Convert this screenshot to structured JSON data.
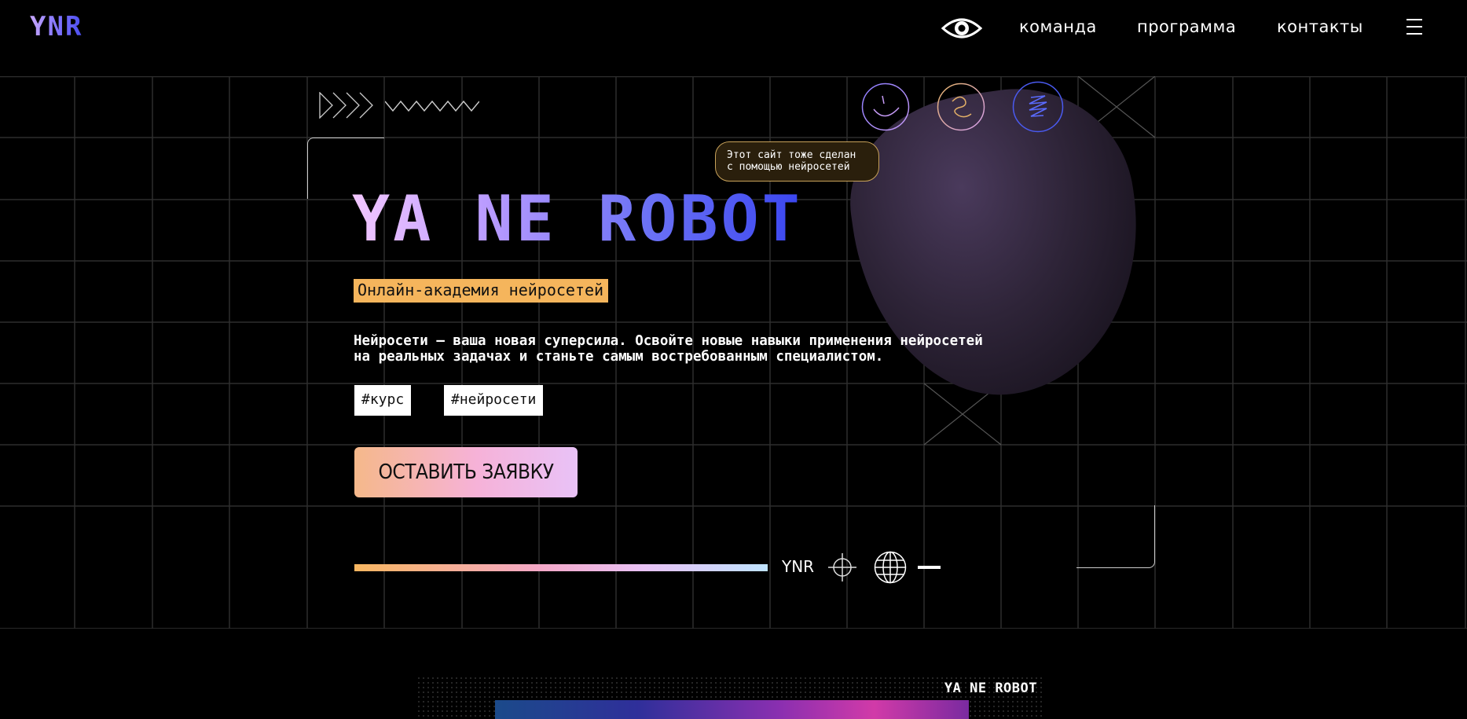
{
  "header": {
    "logo": "YNR",
    "nav": [
      "команда",
      "программа",
      "контакты"
    ]
  },
  "hero": {
    "note_lines": [
      "Этот сайт тоже сделан",
      "с помощью нейросетей"
    ],
    "title": "YA NE ROBOT",
    "subtitle": "Онлайн-академия нейросетей",
    "description_lines": [
      "Нейросети — ваша новая суперсила. Освойте новые навыки применения нейросетей",
      "на реальных задачах и станьте самым востребованным специалистом."
    ],
    "tags": [
      "#курс",
      "#нейросети"
    ],
    "cta": "ОСТАВИТЬ ЗАЯВКУ",
    "footer_label": "YNR"
  },
  "preview": {
    "title": "YA NE ROBOT"
  },
  "colors": {
    "subtitle_bg": "#f5b55c",
    "note_border": "#c8a25a",
    "grid_line": "#333333"
  }
}
